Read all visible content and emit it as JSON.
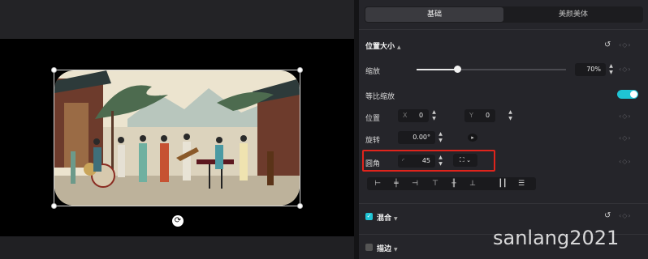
{
  "tabs": {
    "basic": "基础",
    "beauty": "美颜美体"
  },
  "section_position_size": {
    "title": "位置大小"
  },
  "scale": {
    "label": "缩放",
    "value": "70%",
    "level": 0.27
  },
  "uniform_scale": {
    "label": "等比缩放",
    "on": true
  },
  "position": {
    "label": "位置",
    "x_prefix": "X",
    "x_value": "0",
    "y_prefix": "Y",
    "y_value": "0"
  },
  "rotation": {
    "label": "旋转",
    "value": "0.00°"
  },
  "corner_radius": {
    "label": "圆角",
    "value": "45"
  },
  "section_blend": {
    "title": "混合"
  },
  "section_stroke": {
    "title": "描边"
  },
  "watermark": "sanlang2021",
  "colors": {
    "accent": "#1fc4d4",
    "highlight": "#e0241c"
  },
  "icons": [
    "reset-icon",
    "keyframe-diamond-icon",
    "corner-radius-icon",
    "fullscreen-icon",
    "chevron-down-icon",
    "rotate-icon",
    "align-left-icon",
    "align-hcenter-icon",
    "align-right-icon",
    "align-top-icon",
    "align-vcenter-icon",
    "align-bottom-icon",
    "distribute-h-icon",
    "distribute-v-icon"
  ]
}
